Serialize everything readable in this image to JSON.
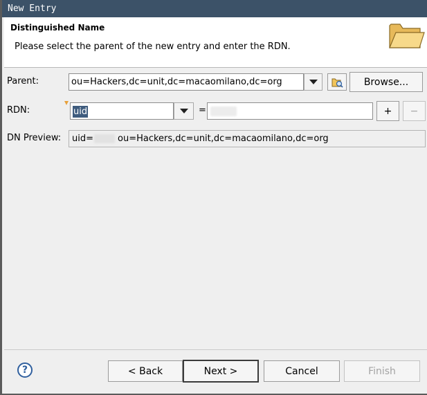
{
  "window": {
    "title": "New Entry"
  },
  "header": {
    "title": "Distinguished Name",
    "description": "Please select the parent of the new entry and enter the RDN."
  },
  "form": {
    "parent": {
      "label": "Parent:",
      "value": "ou=Hackers,dc=unit,dc=macaomilano,dc=org",
      "browse_label": "Browse..."
    },
    "rdn": {
      "label": "RDN:",
      "attribute": "uid",
      "equals": "=",
      "value": "",
      "add_label": "+",
      "remove_label": "−"
    },
    "dn_preview": {
      "label": "DN Preview:",
      "prefix": "uid=",
      "suffix": "ou=Hackers,dc=unit,dc=macaomilano,dc=org"
    }
  },
  "buttons": {
    "help": "?",
    "back": "< Back",
    "next": "Next >",
    "cancel": "Cancel",
    "finish": "Finish"
  }
}
